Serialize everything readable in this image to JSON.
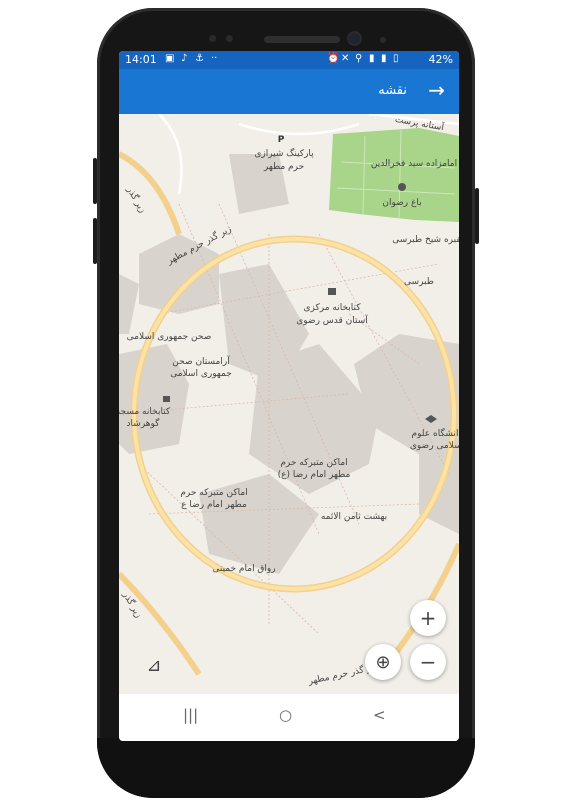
{
  "status_bar": {
    "time": "14:01",
    "battery": "42%",
    "left_icons": [
      "image-icon",
      "music-note-icon",
      "boat-icon",
      "dots-icon"
    ],
    "right_icons": [
      "alarm-icon",
      "mute-icon",
      "location-icon",
      "signal-icon",
      "signal-icon",
      "battery-icon"
    ]
  },
  "app_bar": {
    "title": "نقشه",
    "back_icon": "arrow-icon"
  },
  "map": {
    "labels": {
      "parking": "پارکینگ شیرازی",
      "parking_2": "حرم مطهر",
      "bagh_rezvan": "باغ رضوان",
      "imamzadeh": "امامزاده سید فخرالدین",
      "maqbare": "مقبره شیخ طبرسی",
      "astane_street": "آستانه پرست",
      "tabarsi": "طبرسی",
      "library_1": "کتابخانه مرکزی",
      "library_2": "آستان قدس رضوی",
      "sahn_jomhouri": "صحن جمهوری اسلامی",
      "aramestan_1": "آرامستان صحن",
      "aramestan_2": "جمهوری اسلامی",
      "library_gohar_1": "کتابخانه مسجد",
      "library_gohar_2": "گوهرشاد",
      "university_1": "دانشگاه علوم",
      "university_2": "اسلامی رضوی",
      "amaken_1a": "اماکن متبرکه حرم",
      "amaken_1b": "مطهر امام رضا (ع)",
      "amaken_2a": "اماکن متبرکه حرم",
      "amaken_2b": "مطهر امام رضا ع",
      "behesht": "بهشت ثامن الائمه",
      "ravagh": "رواق امام خمینی",
      "zirgozar_top": "زیر گذر حرم مطهر",
      "zirgozar_bottom": "زیر گذر حرم مطهر",
      "zirgozar_left": "زیر گذر",
      "zirgozar_left_bottom": "زیر گذر",
      "parking_marker": "P"
    }
  },
  "controls": {
    "zoom_in": "+",
    "zoom_out": "−",
    "locate_icon": "crosshair-icon",
    "compass_icon": "ruler-icon"
  },
  "nav": {
    "recent": "|||",
    "home": "○",
    "back": "<"
  }
}
